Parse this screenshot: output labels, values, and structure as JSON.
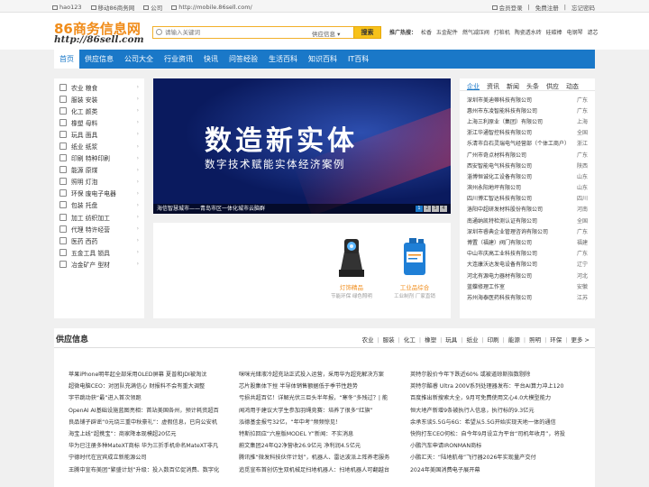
{
  "topbar": {
    "left": [
      "hao123",
      "移动86商务网",
      "公司",
      "http://mobile.86sell.com/"
    ],
    "right": [
      "会员登录",
      "免费注册",
      "忘记密码"
    ]
  },
  "logo": {
    "cn": "86商务信息网",
    "en": "http://86sell.com"
  },
  "search": {
    "placeholder": "请输入关键词",
    "type": "供应信息 ▾",
    "button": "搜索"
  },
  "hot": {
    "label": "推广热搜：",
    "items": [
      "松香",
      "五金配件",
      "燃气减压阀",
      "打桩机",
      "陶瓷透水砖",
      "硅碳棒",
      "电钢琴",
      "滤芯"
    ]
  },
  "nav": [
    "首页",
    "供应信息",
    "公司大全",
    "行业资讯",
    "快讯",
    "问答经验",
    "生活百科",
    "知识百科",
    "IT百科"
  ],
  "categories": [
    "农业 粮食",
    "服装 安装",
    "化工 颜类",
    "橡塑 母料",
    "玩具 面具",
    "纸业 纸浆",
    "印刷 特种印刷",
    "能源 原煤",
    "照明 灯泡",
    "环保 废电子电器",
    "包装 托盘",
    "加工 纺织加工",
    "代理 特许经营",
    "医药 西药",
    "五金工具 锁具",
    "冶金矿产 型材"
  ],
  "banner": {
    "title": "数造新实体",
    "subtitle": "数字技术赋能实体经济案例",
    "caption": "海信智慧城市——青岛市区一体化城市云脑群",
    "pages": [
      "1",
      "2",
      "3",
      "4"
    ]
  },
  "products": [
    {
      "title": "灯饰精品",
      "sub": "节能环保 绿色照明"
    },
    {
      "title": "工业品综合",
      "sub": "工业制剂 厂家直销"
    }
  ],
  "right_tabs": [
    "企业",
    "资讯",
    "新闻",
    "头条",
    "供应",
    "动态"
  ],
  "companies": [
    [
      "深圳市美迪蒂科技有限公司",
      "广东"
    ],
    [
      "惠州市东凌智能科技有限公司",
      "广东"
    ],
    [
      "上海三利原业（集团）有限公司",
      "上海"
    ],
    [
      "浙江华通智控科技有限公司",
      "全国"
    ],
    [
      "乐清市白石灵瑞电气经营部（个体工商户）",
      "浙江"
    ],
    [
      "广州市奇点材料有限公司",
      "广东"
    ],
    [
      "西安智能电气科技有限公司",
      "陕西"
    ],
    [
      "淄博恒诚化工设备有限公司",
      "山东"
    ],
    [
      "滨州永阳地坪有限公司",
      "山东"
    ],
    [
      "四川博汇智达科技有限公司",
      "四川"
    ],
    [
      "洛阳中超研发材料股份有限公司",
      "河南"
    ],
    [
      "南通纳凯特检测认证有限公司",
      "全国"
    ],
    [
      "深圳市睿典企业管理咨询有限公司",
      "广东"
    ],
    [
      "博置（福建）阀门有限公司",
      "福建"
    ],
    [
      "中山市庆高工业科技有限公司",
      "广东"
    ],
    [
      "大连康沃达发电设备有限公司",
      "辽宁"
    ],
    [
      "河北有源电力器材有限公司",
      "河北"
    ],
    [
      "蓝蝶修理工作室",
      "安徽"
    ],
    [
      "苏州海泰医药科技有限公司",
      "江苏"
    ]
  ],
  "section": {
    "title": "供应信息",
    "links": [
      "农业",
      "服装",
      "化工",
      "橡塑",
      "玩具",
      "纸业",
      "印刷",
      "能源",
      "照明",
      "环保",
      "更多 >"
    ]
  },
  "news": [
    [
      "苹果iPhone明年起全部采用OLED屏幕 夏普和JDI被淘汰",
      "超微电脑CEO：对团队充满信心 财报料不会有重大调整",
      "字节跳动获“最”进入首次领跑",
      "OpenAI AI基础设施蓝图亮相：首站美国各州，预计耗资超百",
      "良品铺子辟谣“0元烧三重中秋豪礼”：虚假信息，已向公安机",
      "海宝上线“超携宝”：商家降本现模超20亿元",
      "华为已注册多种MateXT商标 华为三折手机命名MateXT非凡",
      "宁德时代在宜宾成立新能源公司",
      "王腾中宣布美团“繁盛计划”升级：投入数百亿促消费、数字化"
    ],
    [
      "咪咪光储液冷超充站正式投入运营，采用华为超充解决方案",
      "芯片股集体下挫 半导体销售额据低于季节性趋势",
      "亏损共超百亿！详解光伏三巨头半年报，“寒冬”多残过？| 能",
      "闻鸿用于建议大学生参加羽绳竞赛：培养了很多“红旗”",
      "泓德基金报亏32亿，“年中考”频频惊见！",
      "特斯拉回应“六座版MODEL Y”新闻：不实消息",
      "蔚文集团24年Q2净营收26.9亿元 净利润4.5亿元",
      "腾讯推“微发科技伙伴计划”，机器人、雷达波派上阵养老服务",
      "追觅宣布首创仿生双机械足扫地机器人：扫地机器人可翻越台"
    ],
    [
      "英特尔股价今年下跌近60% 或被道琼斯指数剔除",
      "英特尔酷睿 Ultra 200V系列处理器发布：平台AI算力冲上120",
      "百度推出新搜索大全，9月可免费使用文心4.0大模型能力",
      "恒大地产新增9条被执行人信息，执行标的9.3亿元",
      "余承东谈5.5G与6G：希望从5.5G开始实现天地一体的通信",
      "快狗打车CEO何松：自今年9月设立为平台“司机年收月”，将投",
      "小鹏汽车申请IRONMAN商标",
      "小鹏汇天：“陆地航母”飞行器2026年实现量产交付",
      "2024年美国消费电子展开幕"
    ]
  ]
}
